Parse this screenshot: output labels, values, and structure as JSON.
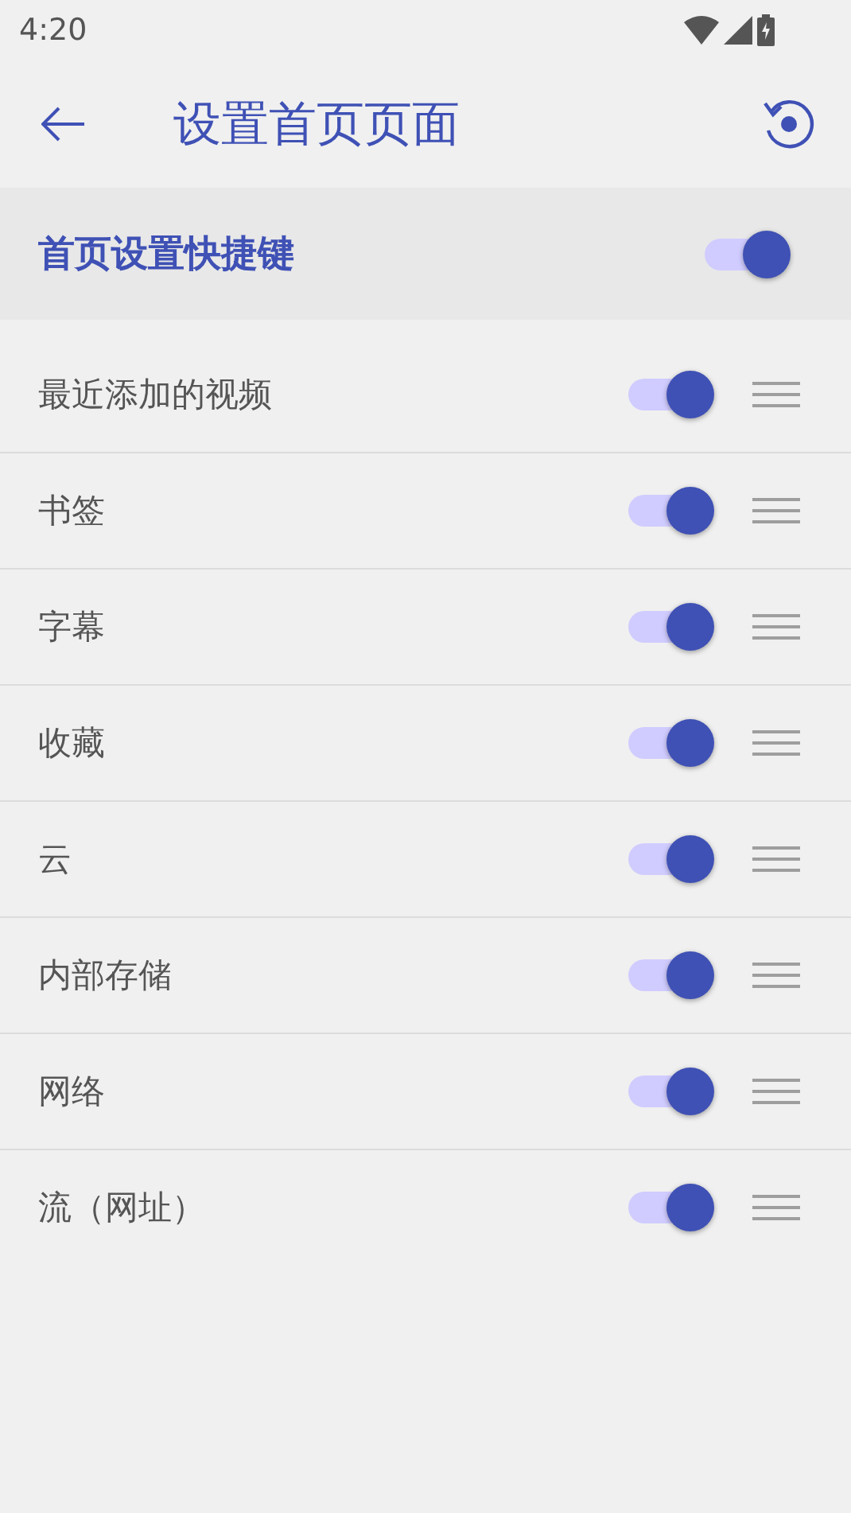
{
  "status_bar": {
    "time": "4:20"
  },
  "app_bar": {
    "title": "设置首页页面"
  },
  "master": {
    "label": "首页设置快捷键",
    "on": true
  },
  "items": [
    {
      "label": "最近添加的视频",
      "on": true
    },
    {
      "label": "书签",
      "on": true
    },
    {
      "label": "字幕",
      "on": true
    },
    {
      "label": "收藏",
      "on": true
    },
    {
      "label": "云",
      "on": true
    },
    {
      "label": "内部存储",
      "on": true
    },
    {
      "label": "网络",
      "on": true
    },
    {
      "label": "流（网址）",
      "on": true
    }
  ]
}
